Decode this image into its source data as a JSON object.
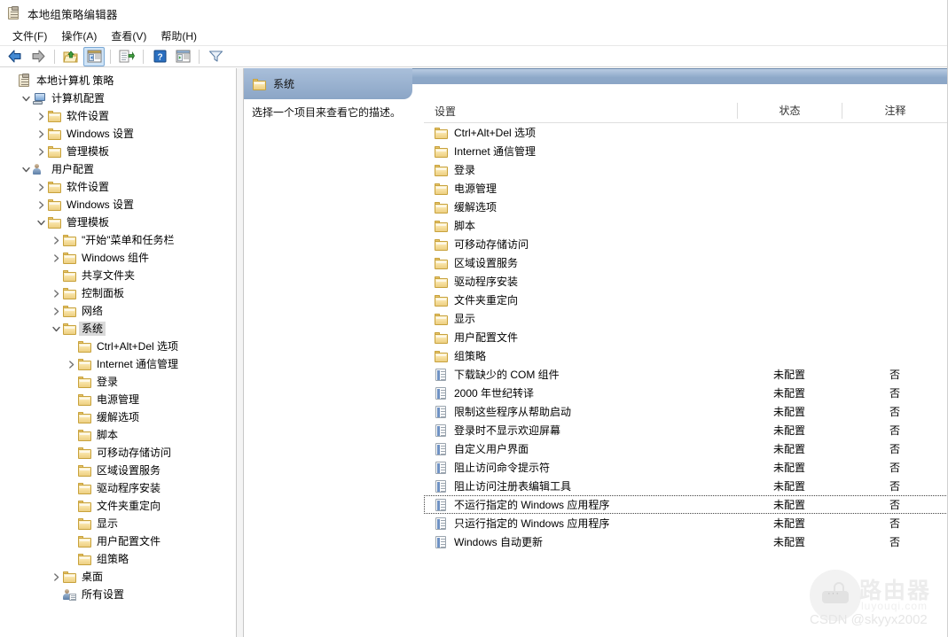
{
  "window": {
    "title": "本地组策略编辑器",
    "icon": "group-policy-editor-icon"
  },
  "menubar": {
    "items": [
      {
        "label": "文件(F)",
        "name": "menu-file"
      },
      {
        "label": "操作(A)",
        "name": "menu-action"
      },
      {
        "label": "查看(V)",
        "name": "menu-view"
      },
      {
        "label": "帮助(H)",
        "name": "menu-help"
      }
    ]
  },
  "toolbar": {
    "buttons": [
      {
        "name": "back-icon",
        "glyph": "back-arrow",
        "pressed": false
      },
      {
        "name": "forward-icon",
        "glyph": "forward-arrow",
        "pressed": false
      },
      {
        "name": "up-one-level-icon",
        "glyph": "folder-up",
        "pressed": false
      },
      {
        "name": "show-hide-console-tree-icon",
        "glyph": "console-tree",
        "pressed": true
      },
      {
        "name": "export-list-icon",
        "glyph": "export-list",
        "pressed": false
      },
      {
        "name": "help-icon",
        "glyph": "question-mark",
        "pressed": false
      },
      {
        "name": "view-icon",
        "glyph": "view-pane",
        "pressed": false
      },
      {
        "name": "filter-icon",
        "glyph": "funnel",
        "pressed": false
      }
    ]
  },
  "tree": {
    "nodes": [
      {
        "label": "本地计算机 策略",
        "indent": 0,
        "icon": "clipboard-icon",
        "expander": "none"
      },
      {
        "label": "计算机配置",
        "indent": 1,
        "icon": "computer-icon",
        "expander": "expanded"
      },
      {
        "label": "软件设置",
        "indent": 2,
        "icon": "folder-icon",
        "expander": "collapsed"
      },
      {
        "label": "Windows 设置",
        "indent": 2,
        "icon": "folder-icon",
        "expander": "collapsed"
      },
      {
        "label": "管理模板",
        "indent": 2,
        "icon": "folder-icon",
        "expander": "collapsed"
      },
      {
        "label": "用户配置",
        "indent": 1,
        "icon": "user-icon",
        "expander": "expanded"
      },
      {
        "label": "软件设置",
        "indent": 2,
        "icon": "folder-icon",
        "expander": "collapsed"
      },
      {
        "label": "Windows 设置",
        "indent": 2,
        "icon": "folder-icon",
        "expander": "collapsed"
      },
      {
        "label": "管理模板",
        "indent": 2,
        "icon": "folder-icon",
        "expander": "expanded"
      },
      {
        "label": "\"开始\"菜单和任务栏",
        "indent": 3,
        "icon": "folder-icon",
        "expander": "collapsed"
      },
      {
        "label": "Windows 组件",
        "indent": 3,
        "icon": "folder-icon",
        "expander": "collapsed"
      },
      {
        "label": "共享文件夹",
        "indent": 3,
        "icon": "folder-icon",
        "expander": "none"
      },
      {
        "label": "控制面板",
        "indent": 3,
        "icon": "folder-icon",
        "expander": "collapsed"
      },
      {
        "label": "网络",
        "indent": 3,
        "icon": "folder-icon",
        "expander": "collapsed"
      },
      {
        "label": "系统",
        "indent": 3,
        "icon": "folder-icon",
        "expander": "expanded",
        "selected": true
      },
      {
        "label": "Ctrl+Alt+Del 选项",
        "indent": 4,
        "icon": "folder-icon",
        "expander": "none"
      },
      {
        "label": "Internet 通信管理",
        "indent": 4,
        "icon": "folder-icon",
        "expander": "collapsed"
      },
      {
        "label": "登录",
        "indent": 4,
        "icon": "folder-icon",
        "expander": "none"
      },
      {
        "label": "电源管理",
        "indent": 4,
        "icon": "folder-icon",
        "expander": "none"
      },
      {
        "label": "缓解选项",
        "indent": 4,
        "icon": "folder-icon",
        "expander": "none"
      },
      {
        "label": "脚本",
        "indent": 4,
        "icon": "folder-icon",
        "expander": "none"
      },
      {
        "label": "可移动存储访问",
        "indent": 4,
        "icon": "folder-icon",
        "expander": "none"
      },
      {
        "label": "区域设置服务",
        "indent": 4,
        "icon": "folder-icon",
        "expander": "none"
      },
      {
        "label": "驱动程序安装",
        "indent": 4,
        "icon": "folder-icon",
        "expander": "none"
      },
      {
        "label": "文件夹重定向",
        "indent": 4,
        "icon": "folder-icon",
        "expander": "none"
      },
      {
        "label": "显示",
        "indent": 4,
        "icon": "folder-icon",
        "expander": "none"
      },
      {
        "label": "用户配置文件",
        "indent": 4,
        "icon": "folder-icon",
        "expander": "none"
      },
      {
        "label": "组策略",
        "indent": 4,
        "icon": "folder-icon",
        "expander": "none"
      },
      {
        "label": "桌面",
        "indent": 3,
        "icon": "folder-icon",
        "expander": "collapsed"
      },
      {
        "label": "所有设置",
        "indent": 3,
        "icon": "all-settings-icon",
        "expander": "none"
      }
    ]
  },
  "right_pane": {
    "header_title": "系统",
    "header_icon": "folder-icon",
    "description": "选择一个项目来查看它的描述。",
    "columns": {
      "setting": "设置",
      "state": "状态",
      "comment": "注释"
    },
    "rows": [
      {
        "name": "Ctrl+Alt+Del 选项",
        "icon": "folder-icon",
        "state": "",
        "comment": ""
      },
      {
        "name": "Internet 通信管理",
        "icon": "folder-icon",
        "state": "",
        "comment": ""
      },
      {
        "name": "登录",
        "icon": "folder-icon",
        "state": "",
        "comment": ""
      },
      {
        "name": "电源管理",
        "icon": "folder-icon",
        "state": "",
        "comment": ""
      },
      {
        "name": "缓解选项",
        "icon": "folder-icon",
        "state": "",
        "comment": ""
      },
      {
        "name": "脚本",
        "icon": "folder-icon",
        "state": "",
        "comment": ""
      },
      {
        "name": "可移动存储访问",
        "icon": "folder-icon",
        "state": "",
        "comment": ""
      },
      {
        "name": "区域设置服务",
        "icon": "folder-icon",
        "state": "",
        "comment": ""
      },
      {
        "name": "驱动程序安装",
        "icon": "folder-icon",
        "state": "",
        "comment": ""
      },
      {
        "name": "文件夹重定向",
        "icon": "folder-icon",
        "state": "",
        "comment": ""
      },
      {
        "name": "显示",
        "icon": "folder-icon",
        "state": "",
        "comment": ""
      },
      {
        "name": "用户配置文件",
        "icon": "folder-icon",
        "state": "",
        "comment": ""
      },
      {
        "name": "组策略",
        "icon": "folder-icon",
        "state": "",
        "comment": ""
      },
      {
        "name": "下载缺少的 COM 组件",
        "icon": "policy-icon",
        "state": "未配置",
        "comment": "否"
      },
      {
        "name": "2000 年世纪转译",
        "icon": "policy-icon",
        "state": "未配置",
        "comment": "否"
      },
      {
        "name": "限制这些程序从帮助启动",
        "icon": "policy-icon",
        "state": "未配置",
        "comment": "否"
      },
      {
        "name": "登录时不显示欢迎屏幕",
        "icon": "policy-icon",
        "state": "未配置",
        "comment": "否"
      },
      {
        "name": "自定义用户界面",
        "icon": "policy-icon",
        "state": "未配置",
        "comment": "否"
      },
      {
        "name": "阻止访问命令提示符",
        "icon": "policy-icon",
        "state": "未配置",
        "comment": "否"
      },
      {
        "name": "阻止访问注册表编辑工具",
        "icon": "policy-icon",
        "state": "未配置",
        "comment": "否"
      },
      {
        "name": "不运行指定的 Windows 应用程序",
        "icon": "policy-icon",
        "state": "未配置",
        "comment": "否",
        "focused": true
      },
      {
        "name": "只运行指定的 Windows 应用程序",
        "icon": "policy-icon",
        "state": "未配置",
        "comment": "否"
      },
      {
        "name": "Windows 自动更新",
        "icon": "policy-icon",
        "state": "未配置",
        "comment": "否"
      }
    ]
  },
  "watermark": {
    "brand_cn": "路由器",
    "brand_en": "luyouqi.com",
    "credit": "CSDN @skyyx2002"
  },
  "colors": {
    "header_band": "#8ba5c6",
    "folder": "#f6de9c",
    "selection": "#d9d9d9"
  }
}
